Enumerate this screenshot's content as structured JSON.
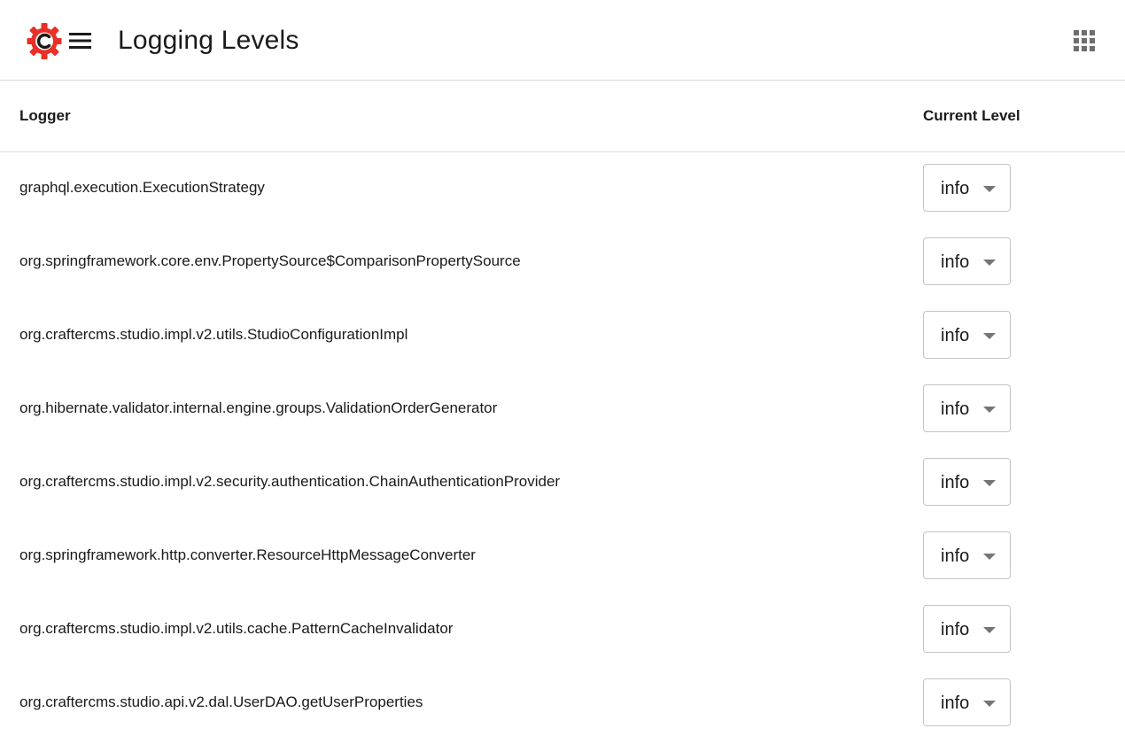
{
  "header": {
    "title": "Logging Levels",
    "logo_icon": "crafter-cms-logo-icon",
    "menu_icon": "hamburger-menu-icon",
    "apps_icon": "apps-grid-icon",
    "brand_color": "#e82f28"
  },
  "table": {
    "columns": {
      "logger": "Logger",
      "level": "Current Level"
    },
    "rows": [
      {
        "logger": "graphql.execution.ExecutionStrategy",
        "level": "info"
      },
      {
        "logger": "org.springframework.core.env.PropertySource$ComparisonPropertySource",
        "level": "info"
      },
      {
        "logger": "org.craftercms.studio.impl.v2.utils.StudioConfigurationImpl",
        "level": "info"
      },
      {
        "logger": "org.hibernate.validator.internal.engine.groups.ValidationOrderGenerator",
        "level": "info"
      },
      {
        "logger": "org.craftercms.studio.impl.v2.security.authentication.ChainAuthenticationProvider",
        "level": "info"
      },
      {
        "logger": "org.springframework.http.converter.ResourceHttpMessageConverter",
        "level": "info"
      },
      {
        "logger": "org.craftercms.studio.impl.v2.utils.cache.PatternCacheInvalidator",
        "level": "info"
      },
      {
        "logger": "org.craftercms.studio.api.v2.dal.UserDAO.getUserProperties",
        "level": "info"
      }
    ]
  }
}
